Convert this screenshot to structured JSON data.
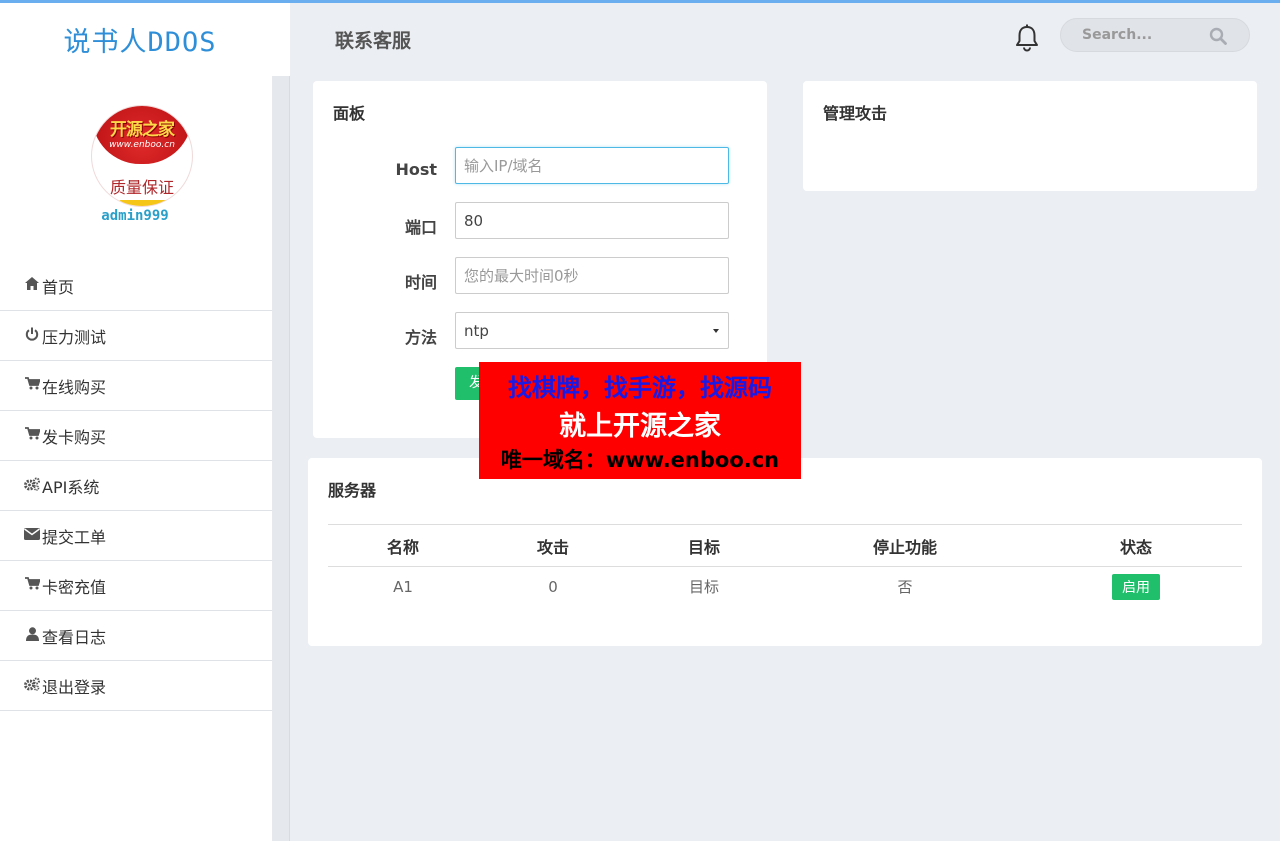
{
  "brand": {
    "title": "说书人DDOS"
  },
  "profile": {
    "logo_title": "开源之家",
    "logo_url": "www.enboo.cn",
    "logo_sub": "质量保证",
    "username": "admin999"
  },
  "menu": {
    "items": [
      {
        "label": "首页",
        "icon": "home-icon"
      },
      {
        "label": "压力测试",
        "icon": "power-icon"
      },
      {
        "label": "在线购买",
        "icon": "cart-icon"
      },
      {
        "label": "发卡购买",
        "icon": "cart-icon"
      },
      {
        "label": "API系统",
        "icon": "gears-icon"
      },
      {
        "label": "提交工单",
        "icon": "envelope-icon"
      },
      {
        "label": "卡密充值",
        "icon": "cart-icon"
      },
      {
        "label": "查看日志",
        "icon": "user-icon"
      },
      {
        "label": "退出登录",
        "icon": "gears-icon"
      }
    ]
  },
  "header": {
    "title": "联系客服",
    "search_placeholder": "Search..."
  },
  "panel": {
    "title": "面板",
    "host_label": "Host",
    "host_placeholder": "输入IP/域名",
    "port_label": "端口",
    "port_value": "80",
    "time_label": "时间",
    "time_placeholder": "您的最大时间0秒",
    "method_label": "方法",
    "method_value": "ntp",
    "submit_label": "发送"
  },
  "manage": {
    "title": "管理攻击"
  },
  "servers": {
    "title": "服务器",
    "columns": [
      "名称",
      "攻击",
      "目标",
      "停止功能",
      "状态"
    ],
    "rows": [
      {
        "name": "A1",
        "attacks": "0",
        "target": "目标",
        "stop": "否",
        "status": "启用"
      }
    ]
  },
  "ad": {
    "line1": "找棋牌，找手游，找源码",
    "line2": "就上开源之家",
    "line3_prefix": "唯一域名：",
    "line3_url": "www.enboo.cn"
  },
  "colors": {
    "accent": "#2e8fd8",
    "success": "#1fbf6b",
    "ad_bg": "#fe0000"
  }
}
